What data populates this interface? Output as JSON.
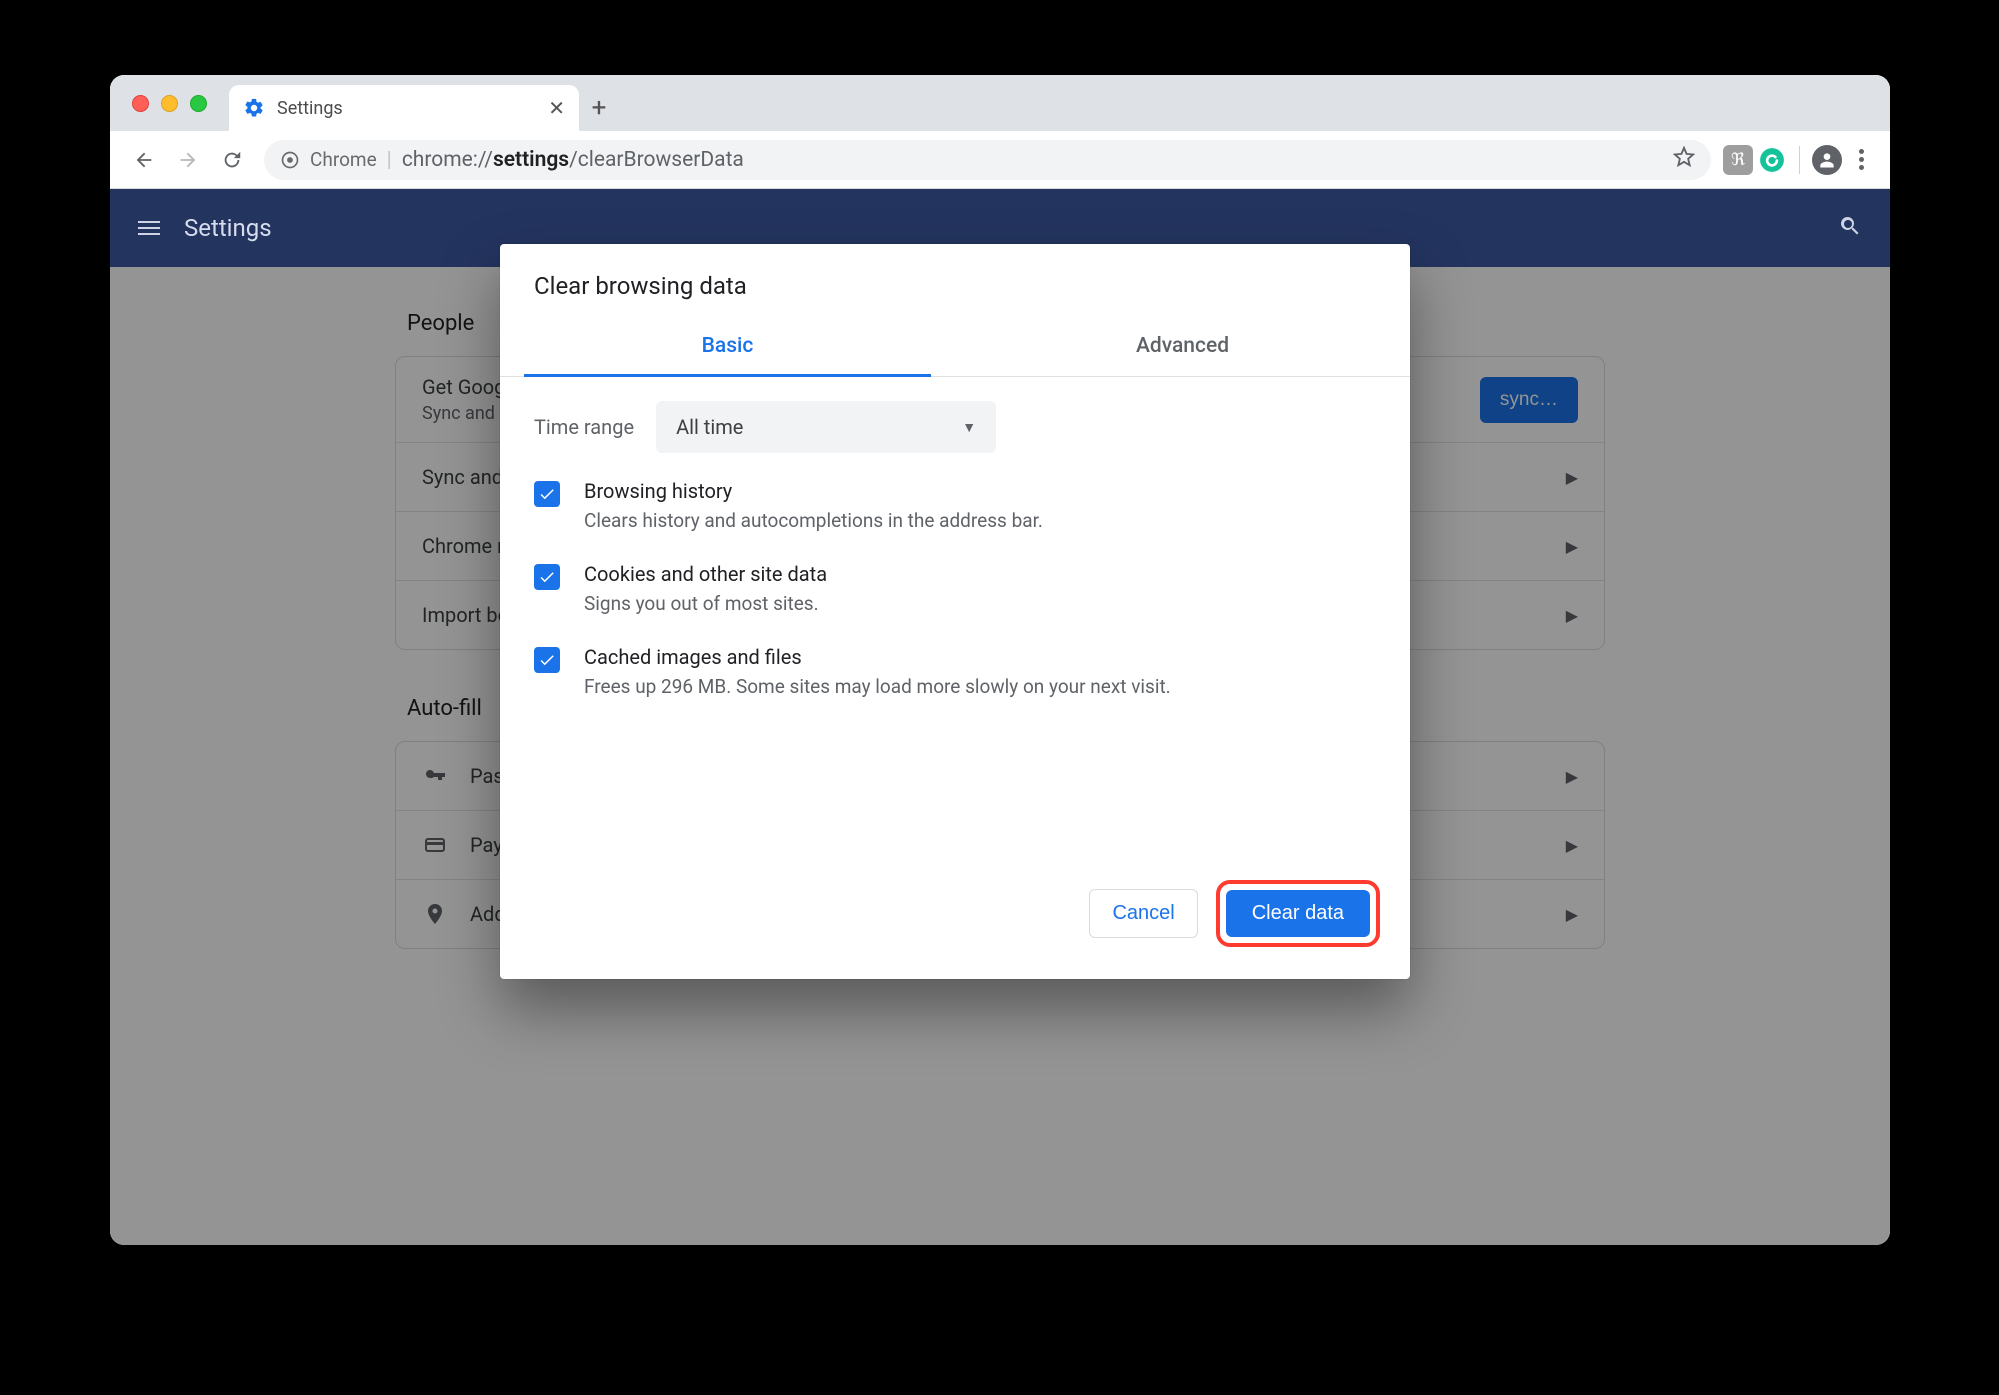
{
  "window": {
    "tab_title": "Settings",
    "chrome_label": "Chrome",
    "url_prefix": "chrome://",
    "url_bold": "settings",
    "url_suffix": "/clearBrowserData"
  },
  "topbar": {
    "title": "Settings"
  },
  "sections": {
    "people": {
      "title": "People",
      "row1_title": "Get Google",
      "row1_sub": "Sync and p",
      "sync_button": "sync…",
      "row2": "Sync and G",
      "row3": "Chrome na",
      "row4": "Import boo"
    },
    "autofill": {
      "title": "Auto-fill",
      "row1": "Pass",
      "row2": "Payn",
      "row3": "Addresses and more"
    }
  },
  "dialog": {
    "title": "Clear browsing data",
    "tabs": {
      "basic": "Basic",
      "advanced": "Advanced"
    },
    "time_range_label": "Time range",
    "time_range_value": "All time",
    "options": [
      {
        "title": "Browsing history",
        "desc": "Clears history and autocompletions in the address bar."
      },
      {
        "title": "Cookies and other site data",
        "desc": "Signs you out of most sites."
      },
      {
        "title": "Cached images and files",
        "desc": "Frees up 296 MB. Some sites may load more slowly on your next visit."
      }
    ],
    "cancel": "Cancel",
    "clear": "Clear data"
  }
}
